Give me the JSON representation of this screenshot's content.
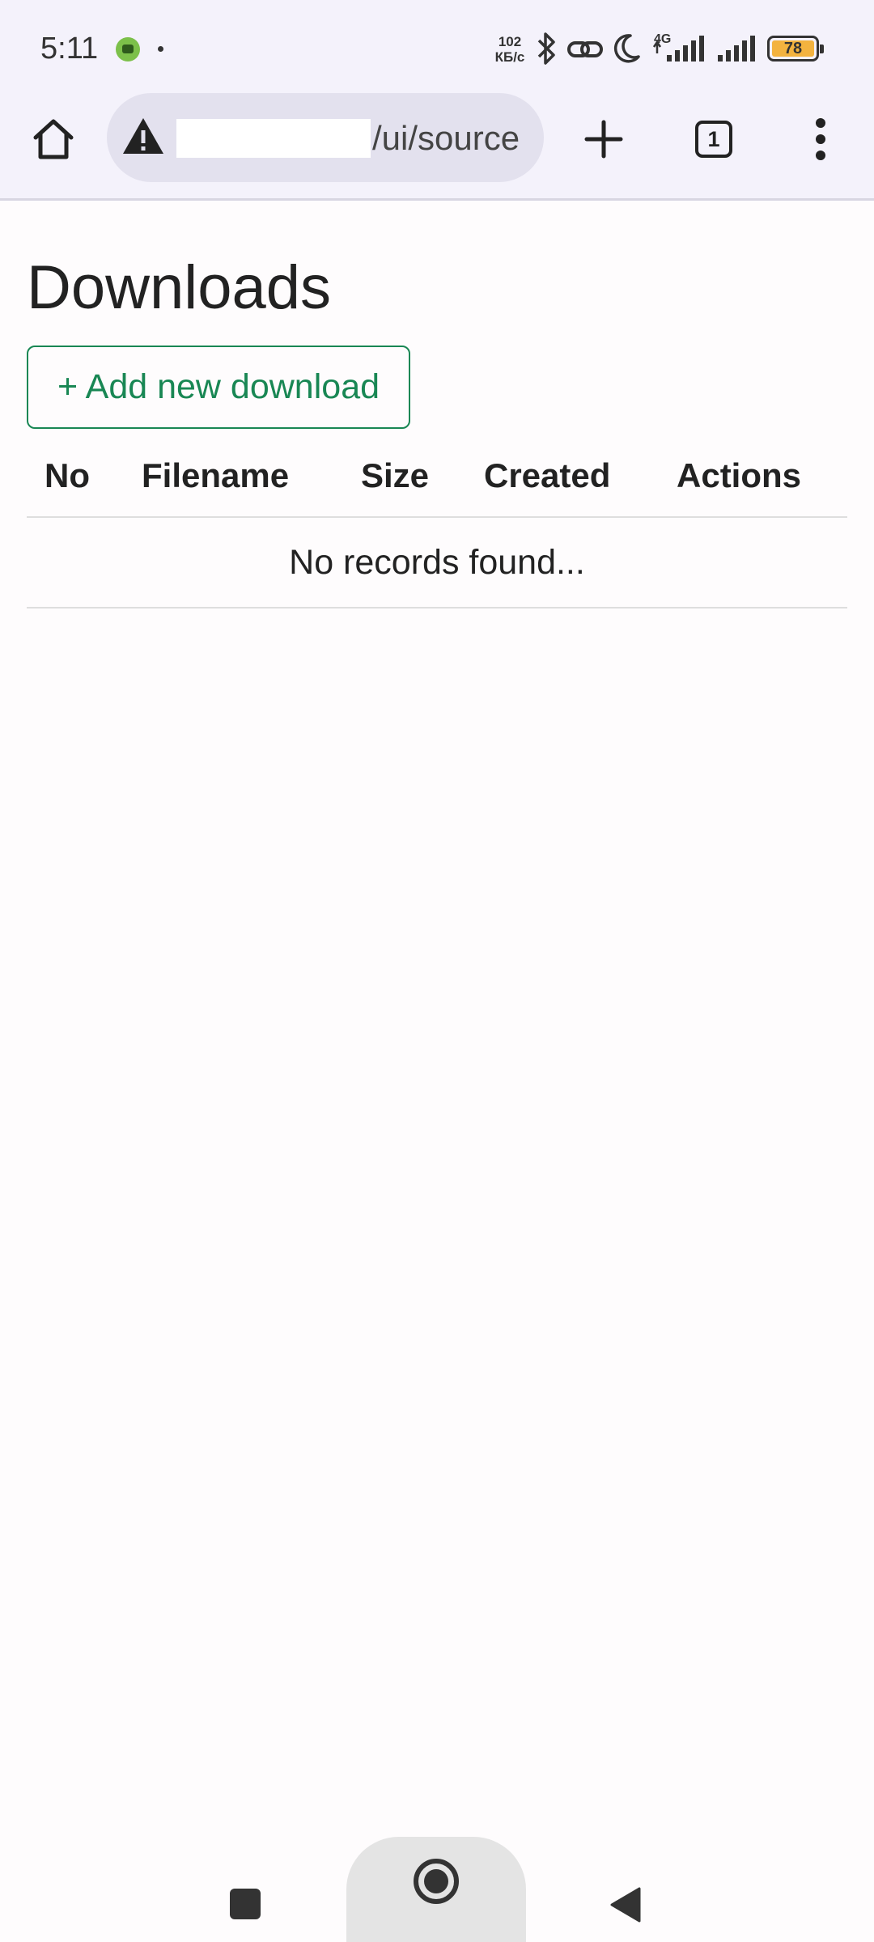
{
  "status_bar": {
    "time": "5:11",
    "net_speed_value": "102",
    "net_speed_unit": "КБ/с",
    "network_type": "4G",
    "battery_level": "78",
    "icons": [
      "app-notification-icon",
      "bluetooth-icon",
      "link-icon",
      "do-not-disturb-icon",
      "signal-icon",
      "battery-icon"
    ]
  },
  "browser": {
    "url_path": "/ui/source",
    "tab_count": "1",
    "icons": [
      "home-icon",
      "warning-icon",
      "plus-icon",
      "tabs-icon",
      "more-vert-icon"
    ]
  },
  "page": {
    "title": "Downloads",
    "add_button_label": "+ Add new download",
    "table": {
      "columns": [
        "No",
        "Filename",
        "Size",
        "Created",
        "Actions"
      ],
      "empty_message": "No records found..."
    }
  },
  "colors": {
    "accent_green": "#198754",
    "browser_chrome": "#f4f2fb",
    "url_bar": "#e3e1ee",
    "battery": "#f3b33f"
  }
}
